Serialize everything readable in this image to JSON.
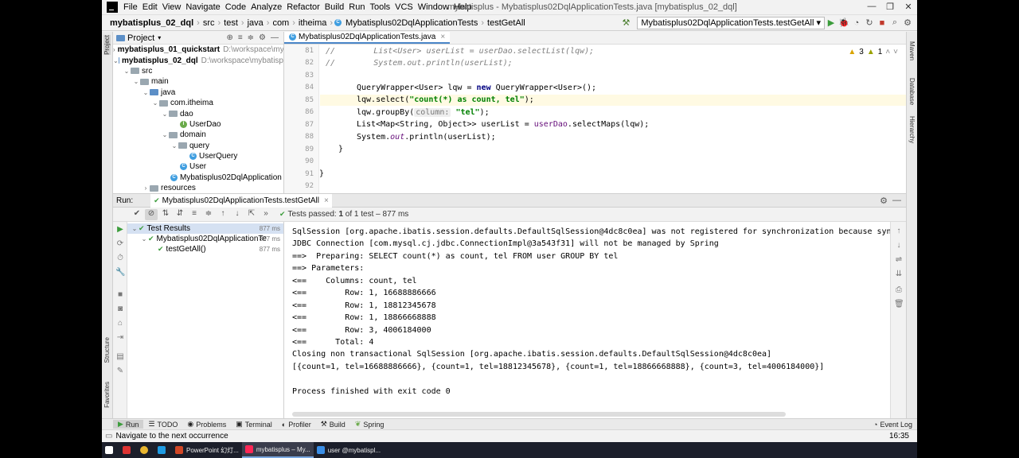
{
  "menu": [
    "File",
    "Edit",
    "View",
    "Navigate",
    "Code",
    "Analyze",
    "Refactor",
    "Build",
    "Run",
    "Tools",
    "VCS",
    "Window",
    "Help"
  ],
  "menu_mnemonics": [
    "F",
    "E",
    "V",
    "N",
    "C",
    "z",
    "R",
    "B",
    "u",
    "T",
    "S",
    "W",
    "H"
  ],
  "window_title": "mybatisplus - Mybatisplus02DqlApplicationTests.java [mybatisplus_02_dql]",
  "breadcrumbs": [
    "mybatisplus_02_dql",
    "src",
    "test",
    "java",
    "com",
    "itheima",
    "Mybatisplus02DqlApplicationTests",
    "testGetAll"
  ],
  "run_config": "Mybatisplus02DqlApplicationTests.testGetAll",
  "project_panel": {
    "title": "Project",
    "items": [
      {
        "label": "mybatisplus_01_quickstart",
        "path": "D:\\workspace\\mybatisp"
      },
      {
        "label": "mybatisplus_02_dql",
        "path": "D:\\workspace\\mybatisp"
      },
      {
        "label": "src"
      },
      {
        "label": "main"
      },
      {
        "label": "java"
      },
      {
        "label": "com.itheima"
      },
      {
        "label": "dao"
      },
      {
        "label": "UserDao"
      },
      {
        "label": "domain"
      },
      {
        "label": "query"
      },
      {
        "label": "UserQuery"
      },
      {
        "label": "User"
      },
      {
        "label": "Mybatisplus02DqlApplication"
      },
      {
        "label": "resources"
      }
    ]
  },
  "editor": {
    "tab": "Mybatisplus02DqlApplicationTests.java",
    "inspections": {
      "warnings": "3",
      "weak": "1"
    },
    "line_numbers": [
      "81",
      "82",
      "83",
      "84",
      "85",
      "86",
      "87",
      "88",
      "89",
      "90",
      "91",
      "92"
    ],
    "lines": {
      "l81_comment": "//        ",
      "l81_code": "List<User> userList = userDao.selectList(lqw);",
      "l82_comment": "//        ",
      "l82_code": "System.out.println(userList);",
      "l84_type": "QueryWrapper<User>",
      "l84_var": " lqw = ",
      "l84_new": "new",
      "l84_rest": " QueryWrapper<User>();",
      "l85_pre": "lqw.select(",
      "l85_str": "\"count(*) as count, tel\"",
      "l85_post": ");",
      "l86_pre": "lqw.groupBy(",
      "l86_hint": "column:",
      "l86_str": "\"tel\"",
      "l86_post": ");",
      "l87_pre": "List<Map<String, Object>> userList = ",
      "l87_fld": "userDao",
      "l87_post": ".selectMaps(lqw);",
      "l88_pre": "System.",
      "l88_fld": "out",
      "l88_post": ".println(userList);",
      "l89": "}",
      "l91": "}"
    }
  },
  "run": {
    "label": "Run:",
    "tab": "Mybatisplus02DqlApplicationTests.testGetAll",
    "status_pre": "Tests passed: ",
    "status_count": "1",
    "status_post": " of 1 test – 877 ms",
    "tree": [
      {
        "label": "Test Results",
        "duration": "877 ms"
      },
      {
        "label": "Mybatisplus02DqlApplicationTe",
        "duration": "877 ms"
      },
      {
        "label": "testGetAll()",
        "duration": "877 ms"
      }
    ],
    "console": [
      "SqlSession [org.apache.ibatis.session.defaults.DefaultSqlSession@4dc8c0ea] was not registered for synchronization because synchr",
      "JDBC Connection [com.mysql.cj.jdbc.ConnectionImpl@3a543f31] will not be managed by Spring",
      "==>  Preparing: SELECT count(*) as count, tel FROM user GROUP BY tel",
      "==> Parameters: ",
      "<==    Columns: count, tel",
      "<==        Row: 1, 16688886666",
      "<==        Row: 1, 18812345678",
      "<==        Row: 1, 18866668888",
      "<==        Row: 3, 4006184000",
      "<==      Total: 4",
      "Closing non transactional SqlSession [org.apache.ibatis.session.defaults.DefaultSqlSession@4dc8c0ea]",
      "[{count=1, tel=16688886666}, {count=1, tel=18812345678}, {count=1, tel=18866668888}, {count=3, tel=4006184000}]",
      "",
      "Process finished with exit code 0"
    ]
  },
  "left_stripe": {
    "project": "Project",
    "structure": "Structure",
    "favorites": "Favorites"
  },
  "right_stripe": {
    "maven": "Maven",
    "database": "Database",
    "hierarchy": "Hierarchy"
  },
  "tool_windows": [
    "Run",
    "TODO",
    "Problems",
    "Terminal",
    "Profiler",
    "Build",
    "Spring"
  ],
  "event_log": "Event Log",
  "status_message": "Navigate to the next occurrence",
  "status_time": "16:35",
  "taskbar": [
    {
      "label": "PowerPoint 幻灯..."
    },
    {
      "label": "mybatisplus – My..."
    },
    {
      "label": "user @mybatispl..."
    }
  ],
  "colors": {
    "accent": "#4a86c8",
    "pass_green": "#3b9c3b",
    "keyword": "#000080",
    "string": "#008000",
    "field": "#660e7a",
    "comment": "#808080"
  }
}
